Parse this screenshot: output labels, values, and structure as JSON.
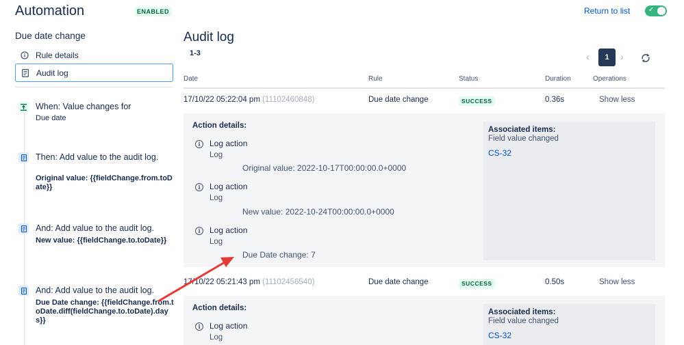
{
  "header": {
    "title": "Automation",
    "badge": "ENABLED",
    "return_link": "Return to list",
    "toggle_on": true,
    "toggle_check": "✓"
  },
  "sidebar": {
    "heading": "Due date change",
    "nav": [
      {
        "label": "Rule details",
        "icon": "info-icon"
      },
      {
        "label": "Audit log",
        "icon": "document-icon",
        "active": true
      }
    ],
    "rules": [
      {
        "icon": "trigger-icon",
        "title": "When: Value changes for",
        "sub": "Due date"
      },
      {
        "icon": "action-icon",
        "title": "Then: Add value to the audit log.",
        "bold": "Original value: {{fieldChange.from.toDate}}"
      },
      {
        "icon": "action-icon",
        "title": "And: Add value to the audit log.",
        "bold": "New value: {{fieldChange.to.toDate}}"
      },
      {
        "icon": "action-icon",
        "title": "And: Add value to the audit log.",
        "bold": "Due Date change: {{fieldChange.from.toDate.diff(fieldChange.to.toDate).days}}"
      }
    ]
  },
  "main": {
    "title": "Audit log",
    "range": "1-3",
    "pagination": {
      "prev": "‹",
      "current": "1",
      "next": "›"
    },
    "refresh_icon": "refresh-icon",
    "columns": [
      "Date",
      "Rule",
      "Status",
      "Duration",
      "Operations"
    ],
    "rows": [
      {
        "date": "17/10/22 05:22:04 pm",
        "id": "(11102460848)",
        "rule": "Due date change",
        "status": "SUCCESS",
        "duration": "0.36s",
        "operation": "Show less",
        "details_title": "Action details:",
        "actions": [
          {
            "name": "Log action",
            "type": "Log",
            "value": "Original value: 2022-10-17T00:00:00.0+0000"
          },
          {
            "name": "Log action",
            "type": "Log",
            "value": "New value: 2022-10-24T00:00:00.0+0000"
          },
          {
            "name": "Log action",
            "type": "Log",
            "value": "Due Date change: 7"
          }
        ],
        "assoc_title": "Associated items:",
        "assoc_sub": "Field value changed",
        "assoc_link": "CS-32"
      },
      {
        "date": "17/10/22 05:21:43 pm",
        "id": "(11102456540)",
        "rule": "Due date change",
        "status": "SUCCESS",
        "duration": "0.50s",
        "operation": "Show less",
        "details_title": "Action details:",
        "actions": [
          {
            "name": "Log action",
            "type": "Log"
          }
        ],
        "assoc_title": "Associated items:",
        "assoc_sub": "Field value changed",
        "assoc_link": "CS-32"
      }
    ]
  },
  "colors": {
    "accent": "#0052cc",
    "success_bg": "#e3fcef",
    "success_text": "#006644",
    "annotation_arrow": "#e53935"
  }
}
